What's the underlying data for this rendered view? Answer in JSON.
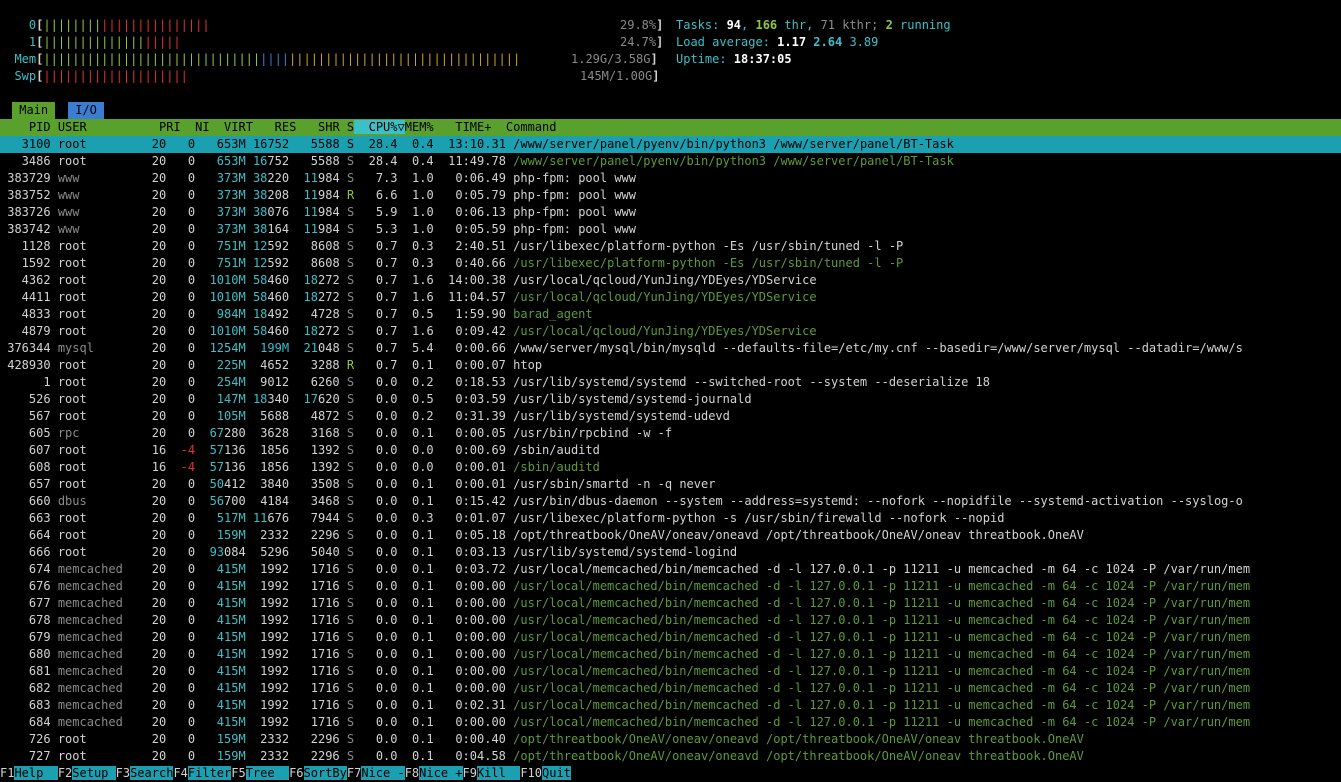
{
  "meters": {
    "cpu0": {
      "label": "0",
      "green": "||||||||",
      "red": "|||||||||||||||",
      "value": "29.8%"
    },
    "cpu1": {
      "label": "1",
      "green": "||||||||||||||",
      "red": "|||||",
      "value": "24.7%"
    },
    "mem": {
      "label": "Mem",
      "green": "||||||||||||||||||||||||||||||",
      "bluebar": "||||",
      "yellow": "||||||||||||||||||||||||||||||||",
      "value": "1.29G/3.58G"
    },
    "swp": {
      "label": "Swp",
      "red": "||||||||||||||||||||",
      "value": "145M/1.00G"
    }
  },
  "summary": {
    "tasks_label": "Tasks: ",
    "tasks": "94",
    "thr": "166",
    "thr_label": " thr, ",
    "kthr": "71 kthr; ",
    "running": "2",
    "running_label": " running",
    "load_label": "Load average: ",
    "load1": "1.17",
    "load5": "2.64",
    "load15": "3.89",
    "uptime_label": "Uptime: ",
    "uptime": "18:37:05"
  },
  "tabs": {
    "main": "Main",
    "io": "I/O"
  },
  "columns": {
    "pid": "PID",
    "user": "USER",
    "pri": "PRI",
    "ni": "NI",
    "virt": "VIRT",
    "res": "RES",
    "shr": "SHR",
    "s": "S",
    "cpu": "CPU%",
    "sort_arrow": "▽",
    "mem": "MEM%",
    "time": "TIME+",
    "command": "Command"
  },
  "processes": [
    {
      "pid": "3100",
      "user": "root",
      "pri": "20",
      "ni": "0",
      "virt": "653M",
      "res": "16752",
      "shr": "5588",
      "s": "S",
      "cpu": "28.4",
      "mem": "0.4",
      "time": "13:10.31",
      "cmd": "/www/server/panel/pyenv/bin/python3 /www/server/panel/BT-Task",
      "thread": false,
      "selected": true
    },
    {
      "pid": "3486",
      "user": "root",
      "pri": "20",
      "ni": "0",
      "virt": "653M",
      "res": "16752",
      "shr": "5588",
      "s": "S",
      "cpu": "28.4",
      "mem": "0.4",
      "time": "11:49.78",
      "cmd": "/www/server/panel/pyenv/bin/python3 /www/server/panel/BT-Task",
      "thread": true
    },
    {
      "pid": "383729",
      "user": "www",
      "pri": "20",
      "ni": "0",
      "virt": "373M",
      "res": "38220",
      "shr": "11984",
      "s": "S",
      "cpu": "7.3",
      "mem": "1.0",
      "time": "0:06.49",
      "cmd": "php-fpm: pool www",
      "thread": false
    },
    {
      "pid": "383752",
      "user": "www",
      "pri": "20",
      "ni": "0",
      "virt": "373M",
      "res": "38208",
      "shr": "11984",
      "s": "R",
      "cpu": "6.6",
      "mem": "1.0",
      "time": "0:05.79",
      "cmd": "php-fpm: pool www",
      "thread": false
    },
    {
      "pid": "383726",
      "user": "www",
      "pri": "20",
      "ni": "0",
      "virt": "373M",
      "res": "38076",
      "shr": "11984",
      "s": "S",
      "cpu": "5.9",
      "mem": "1.0",
      "time": "0:06.13",
      "cmd": "php-fpm: pool www",
      "thread": false
    },
    {
      "pid": "383742",
      "user": "www",
      "pri": "20",
      "ni": "0",
      "virt": "373M",
      "res": "38164",
      "shr": "11984",
      "s": "S",
      "cpu": "5.3",
      "mem": "1.0",
      "time": "0:05.59",
      "cmd": "php-fpm: pool www",
      "thread": false
    },
    {
      "pid": "1128",
      "user": "root",
      "pri": "20",
      "ni": "0",
      "virt": "751M",
      "res": "12592",
      "shr": "8608",
      "s": "S",
      "cpu": "0.7",
      "mem": "0.3",
      "time": "2:40.51",
      "cmd": "/usr/libexec/platform-python -Es /usr/sbin/tuned -l -P",
      "thread": false
    },
    {
      "pid": "1592",
      "user": "root",
      "pri": "20",
      "ni": "0",
      "virt": "751M",
      "res": "12592",
      "shr": "8608",
      "s": "S",
      "cpu": "0.7",
      "mem": "0.3",
      "time": "0:40.66",
      "cmd": "/usr/libexec/platform-python -Es /usr/sbin/tuned -l -P",
      "thread": true
    },
    {
      "pid": "4362",
      "user": "root",
      "pri": "20",
      "ni": "0",
      "virt": "1010M",
      "res": "58460",
      "shr": "18272",
      "s": "S",
      "cpu": "0.7",
      "mem": "1.6",
      "time": "14:00.38",
      "cmd": "/usr/local/qcloud/YunJing/YDEyes/YDService",
      "thread": false
    },
    {
      "pid": "4411",
      "user": "root",
      "pri": "20",
      "ni": "0",
      "virt": "1010M",
      "res": "58460",
      "shr": "18272",
      "s": "S",
      "cpu": "0.7",
      "mem": "1.6",
      "time": "11:04.57",
      "cmd": "/usr/local/qcloud/YunJing/YDEyes/YDService",
      "thread": true
    },
    {
      "pid": "4833",
      "user": "root",
      "pri": "20",
      "ni": "0",
      "virt": "984M",
      "res": "18492",
      "shr": "4728",
      "s": "S",
      "cpu": "0.7",
      "mem": "0.5",
      "time": "1:59.90",
      "cmd": "barad_agent",
      "thread": true
    },
    {
      "pid": "4879",
      "user": "root",
      "pri": "20",
      "ni": "0",
      "virt": "1010M",
      "res": "58460",
      "shr": "18272",
      "s": "S",
      "cpu": "0.7",
      "mem": "1.6",
      "time": "0:09.42",
      "cmd": "/usr/local/qcloud/YunJing/YDEyes/YDService",
      "thread": true
    },
    {
      "pid": "376344",
      "user": "mysql",
      "pri": "20",
      "ni": "0",
      "virt": "1254M",
      "res": "199M",
      "shr": "21048",
      "s": "S",
      "cpu": "0.7",
      "mem": "5.4",
      "time": "0:00.66",
      "cmd": "/www/server/mysql/bin/mysqld --defaults-file=/etc/my.cnf --basedir=/www/server/mysql --datadir=/www/s",
      "thread": false
    },
    {
      "pid": "428930",
      "user": "root",
      "pri": "20",
      "ni": "0",
      "virt": "225M",
      "res": "4652",
      "shr": "3288",
      "s": "R",
      "cpu": "0.7",
      "mem": "0.1",
      "time": "0:00.07",
      "cmd": "htop",
      "thread": false
    },
    {
      "pid": "1",
      "user": "root",
      "pri": "20",
      "ni": "0",
      "virt": "254M",
      "res": "9012",
      "shr": "6260",
      "s": "S",
      "cpu": "0.0",
      "mem": "0.2",
      "time": "0:18.53",
      "cmd": "/usr/lib/systemd/systemd --switched-root --system --deserialize 18",
      "thread": false
    },
    {
      "pid": "526",
      "user": "root",
      "pri": "20",
      "ni": "0",
      "virt": "147M",
      "res": "18340",
      "shr": "17620",
      "s": "S",
      "cpu": "0.0",
      "mem": "0.5",
      "time": "0:03.59",
      "cmd": "/usr/lib/systemd/systemd-journald",
      "thread": false
    },
    {
      "pid": "567",
      "user": "root",
      "pri": "20",
      "ni": "0",
      "virt": "105M",
      "res": "5688",
      "shr": "4872",
      "s": "S",
      "cpu": "0.0",
      "mem": "0.2",
      "time": "0:31.39",
      "cmd": "/usr/lib/systemd/systemd-udevd",
      "thread": false
    },
    {
      "pid": "605",
      "user": "rpc",
      "pri": "20",
      "ni": "0",
      "virt": "67280",
      "res": "3628",
      "shr": "3168",
      "s": "S",
      "cpu": "0.0",
      "mem": "0.1",
      "time": "0:00.05",
      "cmd": "/usr/bin/rpcbind -w -f",
      "thread": false
    },
    {
      "pid": "607",
      "user": "root",
      "pri": "16",
      "ni": "-4",
      "virt": "57136",
      "res": "1856",
      "shr": "1392",
      "s": "S",
      "cpu": "0.0",
      "mem": "0.0",
      "time": "0:00.69",
      "cmd": "/sbin/auditd",
      "thread": false
    },
    {
      "pid": "608",
      "user": "root",
      "pri": "16",
      "ni": "-4",
      "virt": "57136",
      "res": "1856",
      "shr": "1392",
      "s": "S",
      "cpu": "0.0",
      "mem": "0.0",
      "time": "0:00.01",
      "cmd": "/sbin/auditd",
      "thread": true
    },
    {
      "pid": "657",
      "user": "root",
      "pri": "20",
      "ni": "0",
      "virt": "50412",
      "res": "3840",
      "shr": "3508",
      "s": "S",
      "cpu": "0.0",
      "mem": "0.1",
      "time": "0:00.01",
      "cmd": "/usr/sbin/smartd -n -q never",
      "thread": false
    },
    {
      "pid": "660",
      "user": "dbus",
      "pri": "20",
      "ni": "0",
      "virt": "56700",
      "res": "4184",
      "shr": "3468",
      "s": "S",
      "cpu": "0.0",
      "mem": "0.1",
      "time": "0:15.42",
      "cmd": "/usr/bin/dbus-daemon --system --address=systemd: --nofork --nopidfile --systemd-activation --syslog-o",
      "thread": false
    },
    {
      "pid": "663",
      "user": "root",
      "pri": "20",
      "ni": "0",
      "virt": "517M",
      "res": "11676",
      "shr": "7944",
      "s": "S",
      "cpu": "0.0",
      "mem": "0.3",
      "time": "0:01.07",
      "cmd": "/usr/libexec/platform-python -s /usr/sbin/firewalld --nofork --nopid",
      "thread": false
    },
    {
      "pid": "664",
      "user": "root",
      "pri": "20",
      "ni": "0",
      "virt": "159M",
      "res": "2332",
      "shr": "2296",
      "s": "S",
      "cpu": "0.0",
      "mem": "0.1",
      "time": "0:05.18",
      "cmd": "/opt/threatbook/OneAV/oneav/oneavd /opt/threatbook/OneAV/oneav threatbook.OneAV",
      "thread": false
    },
    {
      "pid": "666",
      "user": "root",
      "pri": "20",
      "ni": "0",
      "virt": "93084",
      "res": "5296",
      "shr": "5040",
      "s": "S",
      "cpu": "0.0",
      "mem": "0.1",
      "time": "0:03.13",
      "cmd": "/usr/lib/systemd/systemd-logind",
      "thread": false
    },
    {
      "pid": "674",
      "user": "memcached",
      "pri": "20",
      "ni": "0",
      "virt": "415M",
      "res": "1992",
      "shr": "1716",
      "s": "S",
      "cpu": "0.0",
      "mem": "0.1",
      "time": "0:03.72",
      "cmd": "/usr/local/memcached/bin/memcached -d -l 127.0.0.1 -p 11211 -u memcached -m 64 -c 1024 -P /var/run/mem",
      "thread": false
    },
    {
      "pid": "676",
      "user": "memcached",
      "pri": "20",
      "ni": "0",
      "virt": "415M",
      "res": "1992",
      "shr": "1716",
      "s": "S",
      "cpu": "0.0",
      "mem": "0.1",
      "time": "0:00.00",
      "cmd": "/usr/local/memcached/bin/memcached -d -l 127.0.0.1 -p 11211 -u memcached -m 64 -c 1024 -P /var/run/mem",
      "thread": true
    },
    {
      "pid": "677",
      "user": "memcached",
      "pri": "20",
      "ni": "0",
      "virt": "415M",
      "res": "1992",
      "shr": "1716",
      "s": "S",
      "cpu": "0.0",
      "mem": "0.1",
      "time": "0:00.00",
      "cmd": "/usr/local/memcached/bin/memcached -d -l 127.0.0.1 -p 11211 -u memcached -m 64 -c 1024 -P /var/run/mem",
      "thread": true
    },
    {
      "pid": "678",
      "user": "memcached",
      "pri": "20",
      "ni": "0",
      "virt": "415M",
      "res": "1992",
      "shr": "1716",
      "s": "S",
      "cpu": "0.0",
      "mem": "0.1",
      "time": "0:00.00",
      "cmd": "/usr/local/memcached/bin/memcached -d -l 127.0.0.1 -p 11211 -u memcached -m 64 -c 1024 -P /var/run/mem",
      "thread": true
    },
    {
      "pid": "679",
      "user": "memcached",
      "pri": "20",
      "ni": "0",
      "virt": "415M",
      "res": "1992",
      "shr": "1716",
      "s": "S",
      "cpu": "0.0",
      "mem": "0.1",
      "time": "0:00.00",
      "cmd": "/usr/local/memcached/bin/memcached -d -l 127.0.0.1 -p 11211 -u memcached -m 64 -c 1024 -P /var/run/mem",
      "thread": true
    },
    {
      "pid": "680",
      "user": "memcached",
      "pri": "20",
      "ni": "0",
      "virt": "415M",
      "res": "1992",
      "shr": "1716",
      "s": "S",
      "cpu": "0.0",
      "mem": "0.1",
      "time": "0:00.00",
      "cmd": "/usr/local/memcached/bin/memcached -d -l 127.0.0.1 -p 11211 -u memcached -m 64 -c 1024 -P /var/run/mem",
      "thread": true
    },
    {
      "pid": "681",
      "user": "memcached",
      "pri": "20",
      "ni": "0",
      "virt": "415M",
      "res": "1992",
      "shr": "1716",
      "s": "S",
      "cpu": "0.0",
      "mem": "0.1",
      "time": "0:00.00",
      "cmd": "/usr/local/memcached/bin/memcached -d -l 127.0.0.1 -p 11211 -u memcached -m 64 -c 1024 -P /var/run/mem",
      "thread": true
    },
    {
      "pid": "682",
      "user": "memcached",
      "pri": "20",
      "ni": "0",
      "virt": "415M",
      "res": "1992",
      "shr": "1716",
      "s": "S",
      "cpu": "0.0",
      "mem": "0.1",
      "time": "0:00.00",
      "cmd": "/usr/local/memcached/bin/memcached -d -l 127.0.0.1 -p 11211 -u memcached -m 64 -c 1024 -P /var/run/mem",
      "thread": true
    },
    {
      "pid": "683",
      "user": "memcached",
      "pri": "20",
      "ni": "0",
      "virt": "415M",
      "res": "1992",
      "shr": "1716",
      "s": "S",
      "cpu": "0.0",
      "mem": "0.1",
      "time": "0:02.31",
      "cmd": "/usr/local/memcached/bin/memcached -d -l 127.0.0.1 -p 11211 -u memcached -m 64 -c 1024 -P /var/run/mem",
      "thread": true
    },
    {
      "pid": "684",
      "user": "memcached",
      "pri": "20",
      "ni": "0",
      "virt": "415M",
      "res": "1992",
      "shr": "1716",
      "s": "S",
      "cpu": "0.0",
      "mem": "0.1",
      "time": "0:00.00",
      "cmd": "/usr/local/memcached/bin/memcached -d -l 127.0.0.1 -p 11211 -u memcached -m 64 -c 1024 -P /var/run/mem",
      "thread": true
    },
    {
      "pid": "726",
      "user": "root",
      "pri": "20",
      "ni": "0",
      "virt": "159M",
      "res": "2332",
      "shr": "2296",
      "s": "S",
      "cpu": "0.0",
      "mem": "0.1",
      "time": "0:00.40",
      "cmd": "/opt/threatbook/OneAV/oneav/oneavd /opt/threatbook/OneAV/oneav threatbook.OneAV",
      "thread": true
    },
    {
      "pid": "727",
      "user": "root",
      "pri": "20",
      "ni": "0",
      "virt": "159M",
      "res": "2332",
      "shr": "2296",
      "s": "S",
      "cpu": "0.0",
      "mem": "0.1",
      "time": "0:04.58",
      "cmd": "/opt/threatbook/OneAV/oneav/oneavd /opt/threatbook/OneAV/oneav threatbook.OneAV",
      "thread": true
    }
  ],
  "function_bar": [
    {
      "key": "F1",
      "label": "Help  "
    },
    {
      "key": "F2",
      "label": "Setup "
    },
    {
      "key": "F3",
      "label": "Search"
    },
    {
      "key": "F4",
      "label": "Filter"
    },
    {
      "key": "F5",
      "label": "Tree  "
    },
    {
      "key": "F6",
      "label": "SortBy"
    },
    {
      "key": "F7",
      "label": "Nice -"
    },
    {
      "key": "F8",
      "label": "Nice +"
    },
    {
      "key": "F9",
      "label": "Kill  "
    },
    {
      "key": "F10",
      "label": "Quit"
    }
  ],
  "colors": {
    "header_bg": "#5aa02c",
    "selection_bg": "#1aa0b0",
    "thread": "#5e9a3a",
    "accent": "#3cc0c7"
  }
}
